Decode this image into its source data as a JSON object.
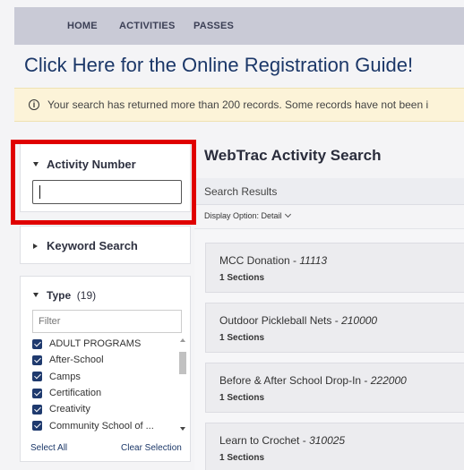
{
  "nav": {
    "items": [
      "HOME",
      "ACTIVITIES",
      "PASSES"
    ]
  },
  "guide_link": "Click Here for the Online Registration Guide!",
  "alert": {
    "icon": "info-icon",
    "text": "Your search has returned more than 200 records. Some records have not been i"
  },
  "sidebar": {
    "activity_number": {
      "title": "Activity Number",
      "value": ""
    },
    "keyword_search": {
      "title": "Keyword Search"
    },
    "type": {
      "title": "Type",
      "count": "(19)",
      "filter_placeholder": "Filter",
      "items": [
        "ADULT PROGRAMS",
        "After-School",
        "Camps",
        "Certification",
        "Creativity",
        "Community School of ..."
      ],
      "select_all": "Select All",
      "clear_selection": "Clear Selection"
    }
  },
  "main": {
    "title": "WebTrac Activity Search",
    "results_label": "Search Results",
    "display_option": "Display Option: Detail",
    "results": [
      {
        "name": "MCC Donation - ",
        "number": "11113",
        "sections": "1 Sections"
      },
      {
        "name": "Outdoor Pickleball Nets - ",
        "number": "210000",
        "sections": "1 Sections"
      },
      {
        "name": "Before & After School Drop-In - ",
        "number": "222000",
        "sections": "1 Sections"
      },
      {
        "name": "Learn to Crochet - ",
        "number": "310025",
        "sections": "1 Sections"
      }
    ]
  },
  "colors": {
    "highlight_box": "#e00000",
    "checkbox": "#1f3a6e",
    "nav_bg": "#c9cad6"
  }
}
